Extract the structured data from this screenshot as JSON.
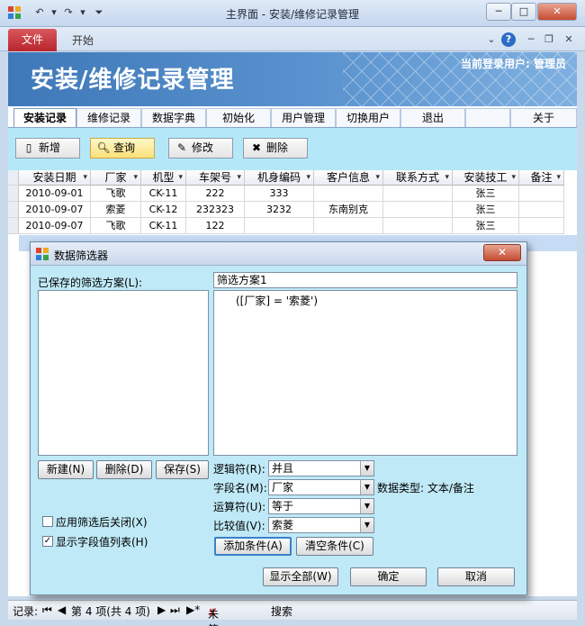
{
  "window": {
    "title": "主界面 - 安装/维修记录管理",
    "min": "─",
    "max": "□",
    "close": "✕"
  },
  "ribbon": {
    "file_tab": "文件",
    "home_tab": "开始",
    "help": "?",
    "min": "─",
    "restore": "❐",
    "close": "✕",
    "expand": "⌄"
  },
  "banner": {
    "title": "安装/维修记录管理",
    "user": "当前登录用户: 管理员"
  },
  "nav": [
    "安装记录",
    "维修记录",
    "数据字典",
    "初始化",
    "用户管理",
    "切换用户",
    "退出",
    "关于"
  ],
  "toolbar": {
    "new": "新增",
    "query": "查询",
    "edit": "修改",
    "delete": "删除"
  },
  "table": {
    "columns": [
      "安装日期",
      "厂家",
      "机型",
      "车架号",
      "机身编码",
      "客户信息",
      "联系方式",
      "安装技工",
      "备注"
    ],
    "rows": [
      [
        "2010-09-01",
        "飞歌",
        "CK-11",
        "222",
        "333",
        "",
        "",
        "张三",
        ""
      ],
      [
        "2010-09-07",
        "索菱",
        "CK-12",
        "232323",
        "3232",
        "东南别克",
        "",
        "张三",
        ""
      ],
      [
        "2010-09-07",
        "飞歌",
        "CK-11",
        "122",
        "",
        "",
        "",
        "张三",
        ""
      ]
    ]
  },
  "status": {
    "record_label": "记录:",
    "first": "⏮",
    "prev": "◀",
    "position": "第 4 项(共 4 项)",
    "next": "▶",
    "last": "⏭",
    "new": "▶*",
    "filter": "未筛选",
    "search": "搜索"
  },
  "dialog": {
    "title": "数据筛选器",
    "close": "✕",
    "saved_label": "已保存的筛选方案(L):",
    "scheme_name": "筛选方案1",
    "condition": "([厂家] = '索菱')",
    "btn_new": "新建(N)",
    "btn_delete": "删除(D)",
    "btn_save": "保存(S)",
    "logic_label": "逻辑符(R):",
    "logic_value": "并且",
    "field_label": "字段名(M):",
    "field_value": "厂家",
    "type_label": "数据类型: 文本/备注",
    "op_label": "运算符(U):",
    "op_value": "等于",
    "cmp_label": "比较值(V):",
    "cmp_value": "索菱",
    "chk_close_label": "应用筛选后关闭(X)",
    "chk_close": false,
    "chk_list_label": "显示字段值列表(H)",
    "chk_list": true,
    "btn_add": "添加条件(A)",
    "btn_clear": "清空条件(C)",
    "btn_showall": "显示全部(W)",
    "btn_ok": "确定",
    "btn_cancel": "取消"
  }
}
